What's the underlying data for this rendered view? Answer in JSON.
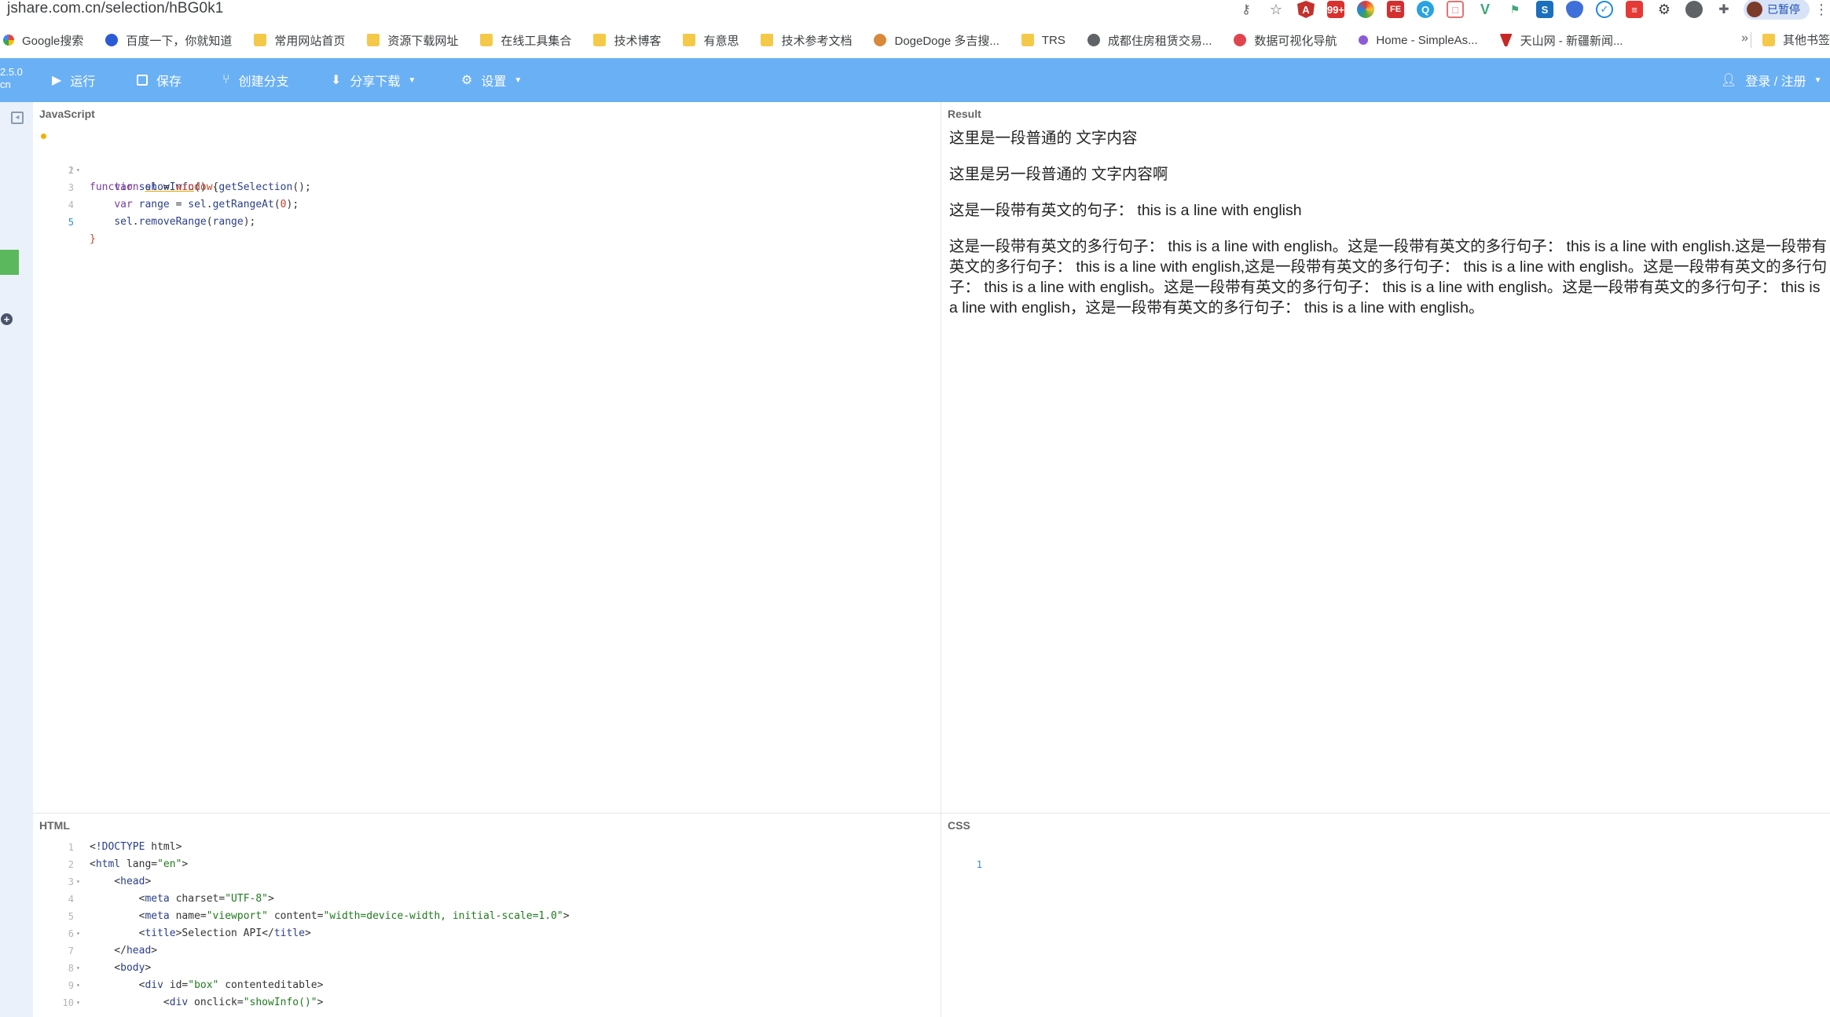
{
  "browser": {
    "url": "jshare.com.cn/selection/hBG0k1",
    "profile_label": "已暂停",
    "bookmarks": [
      {
        "label": "Google搜索",
        "icon": "google-icon"
      },
      {
        "label": "百度一下，你就知道",
        "icon": "baidu-icon"
      },
      {
        "label": "常用网站首页",
        "icon": "folder-icon"
      },
      {
        "label": "资源下载网址",
        "icon": "folder-icon"
      },
      {
        "label": "在线工具集合",
        "icon": "folder-icon"
      },
      {
        "label": "技术博客",
        "icon": "folder-icon"
      },
      {
        "label": "有意思",
        "icon": "folder-icon"
      },
      {
        "label": "技术参考文档",
        "icon": "folder-icon"
      },
      {
        "label": "DogeDoge 多吉搜...",
        "icon": "dogedoge-icon"
      },
      {
        "label": "TRS",
        "icon": "folder-icon"
      },
      {
        "label": "成都住房租赁交易...",
        "icon": "globe-icon"
      },
      {
        "label": "数据可视化导航",
        "icon": "datavis-icon"
      },
      {
        "label": "Home - SimpleAs...",
        "icon": "simpleas-icon"
      },
      {
        "label": "天山网 - 新疆新闻...",
        "icon": "tianshan-icon"
      }
    ],
    "bookmarks_more": "»",
    "other_bookmarks": "其他书签"
  },
  "toolbar": {
    "version_line1": "2.5.0",
    "version_line2": "cn",
    "run": "运行",
    "save": "保存",
    "branch": "创建分支",
    "share": "分享下载",
    "settings": "设置",
    "login": "登录 / 注册"
  },
  "panes": {
    "js_title": "JavaScript",
    "result_title": "Result",
    "html_title": "HTML",
    "css_title": "CSS"
  },
  "js_code": {
    "line1": "function showInfo() {",
    "line2": "    var sel = window.getSelection();",
    "line3": "    var range = sel.getRangeAt(0);",
    "line4": "    sel.removeRange(range);",
    "line5": "}"
  },
  "result": {
    "p1": "这里是一段普通的 文字内容",
    "p2": "这里是另一段普通的 文字内容啊",
    "p3": "这是一段带有英文的句子：  this is a line with english",
    "p4": "这是一段带有英文的多行句子：  this is a line with english。这是一段带有英文的多行句子：  this is a line with english.这是一段带有英文的多行句子：  this is a line with english,这是一段带有英文的多行句子：  this is a line with english。这是一段带有英文的多行句子：  this is a line with english。这是一段带有英文的多行句子：  this is a line with english。这是一段带有英文的多行句子：  this is a line with english，这是一段带有英文的多行句子：  this is a line with english。"
  },
  "html_code": [
    "<!DOCTYPE html>",
    "<html lang=\"en\">",
    "    <head>",
    "        <meta charset=\"UTF-8\">",
    "        <meta name=\"viewport\" content=\"width=device-width, initial-scale=1.0\">",
    "        <title>Selection API</title>",
    "    </head>",
    "    <body>",
    "        <div id=\"box\" contenteditable>",
    "            <div onclick=\"showInfo()\">"
  ],
  "css_code": {
    "line1_number": "1"
  }
}
